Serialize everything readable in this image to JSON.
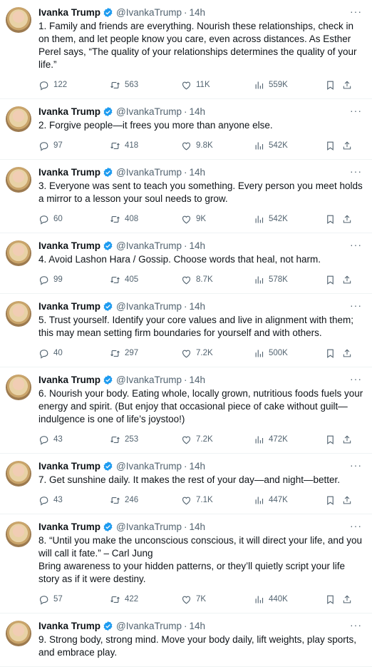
{
  "author": {
    "name": "Ivanka Trump",
    "handle": "@IvankaTrump",
    "separator": "·",
    "time": "14h"
  },
  "colors": {
    "verified": "#1d9bf0",
    "muted": "#536471",
    "text": "#0f1419"
  },
  "icons": [
    "verified-badge-icon",
    "more-icon",
    "reply-icon",
    "retweet-icon",
    "like-icon",
    "views-icon",
    "bookmark-icon",
    "share-icon"
  ],
  "more_label": "···",
  "tweets": [
    {
      "text": "1. Family and friends are everything. Nourish these relationships, check in on them, and let people know you care, even across distances. As Esther Perel says, “The quality of your relationships determines the quality of your life.”",
      "replies": "122",
      "retweets": "563",
      "likes": "11K",
      "views": "559K"
    },
    {
      "text": "2. Forgive people—it frees you more than anyone else.",
      "replies": "97",
      "retweets": "418",
      "likes": "9.8K",
      "views": "542K"
    },
    {
      "text": "3. Everyone was sent to teach you something. Every person you meet holds a mirror to a lesson your soul needs to grow.",
      "replies": "60",
      "retweets": "408",
      "likes": "9K",
      "views": "542K"
    },
    {
      "text": "4. Avoid Lashon Hara / Gossip. Choose words that heal, not harm.",
      "replies": "99",
      "retweets": "405",
      "likes": "8.7K",
      "views": "578K"
    },
    {
      "text": "5. Trust yourself. Identify your core values and live in alignment with them; this may mean setting firm boundaries for yourself and with others.",
      "replies": "40",
      "retweets": "297",
      "likes": "7.2K",
      "views": "500K"
    },
    {
      "text": "6. Nourish your body. Eating whole, locally grown, nutritious foods fuels your energy and spirit. (But enjoy that occasional piece of cake without guilt—indulgence is one of life’s joystoo!)",
      "replies": "43",
      "retweets": "253",
      "likes": "7.2K",
      "views": "472K"
    },
    {
      "text": "7. Get sunshine daily. It makes the rest of your day—and night—better.",
      "replies": "43",
      "retweets": "246",
      "likes": "7.1K",
      "views": "447K"
    },
    {
      "text": "8. “Until you make the unconscious conscious, it will direct your life, and you will call it fate.” – Carl Jung\nBring awareness to your hidden patterns, or they’ll quietly script your life story as if it were destiny.",
      "replies": "57",
      "retweets": "422",
      "likes": "7K",
      "views": "440K"
    },
    {
      "text": "9. Strong body, strong mind. Move your body daily, lift weights, play sports, and embrace play."
    }
  ]
}
